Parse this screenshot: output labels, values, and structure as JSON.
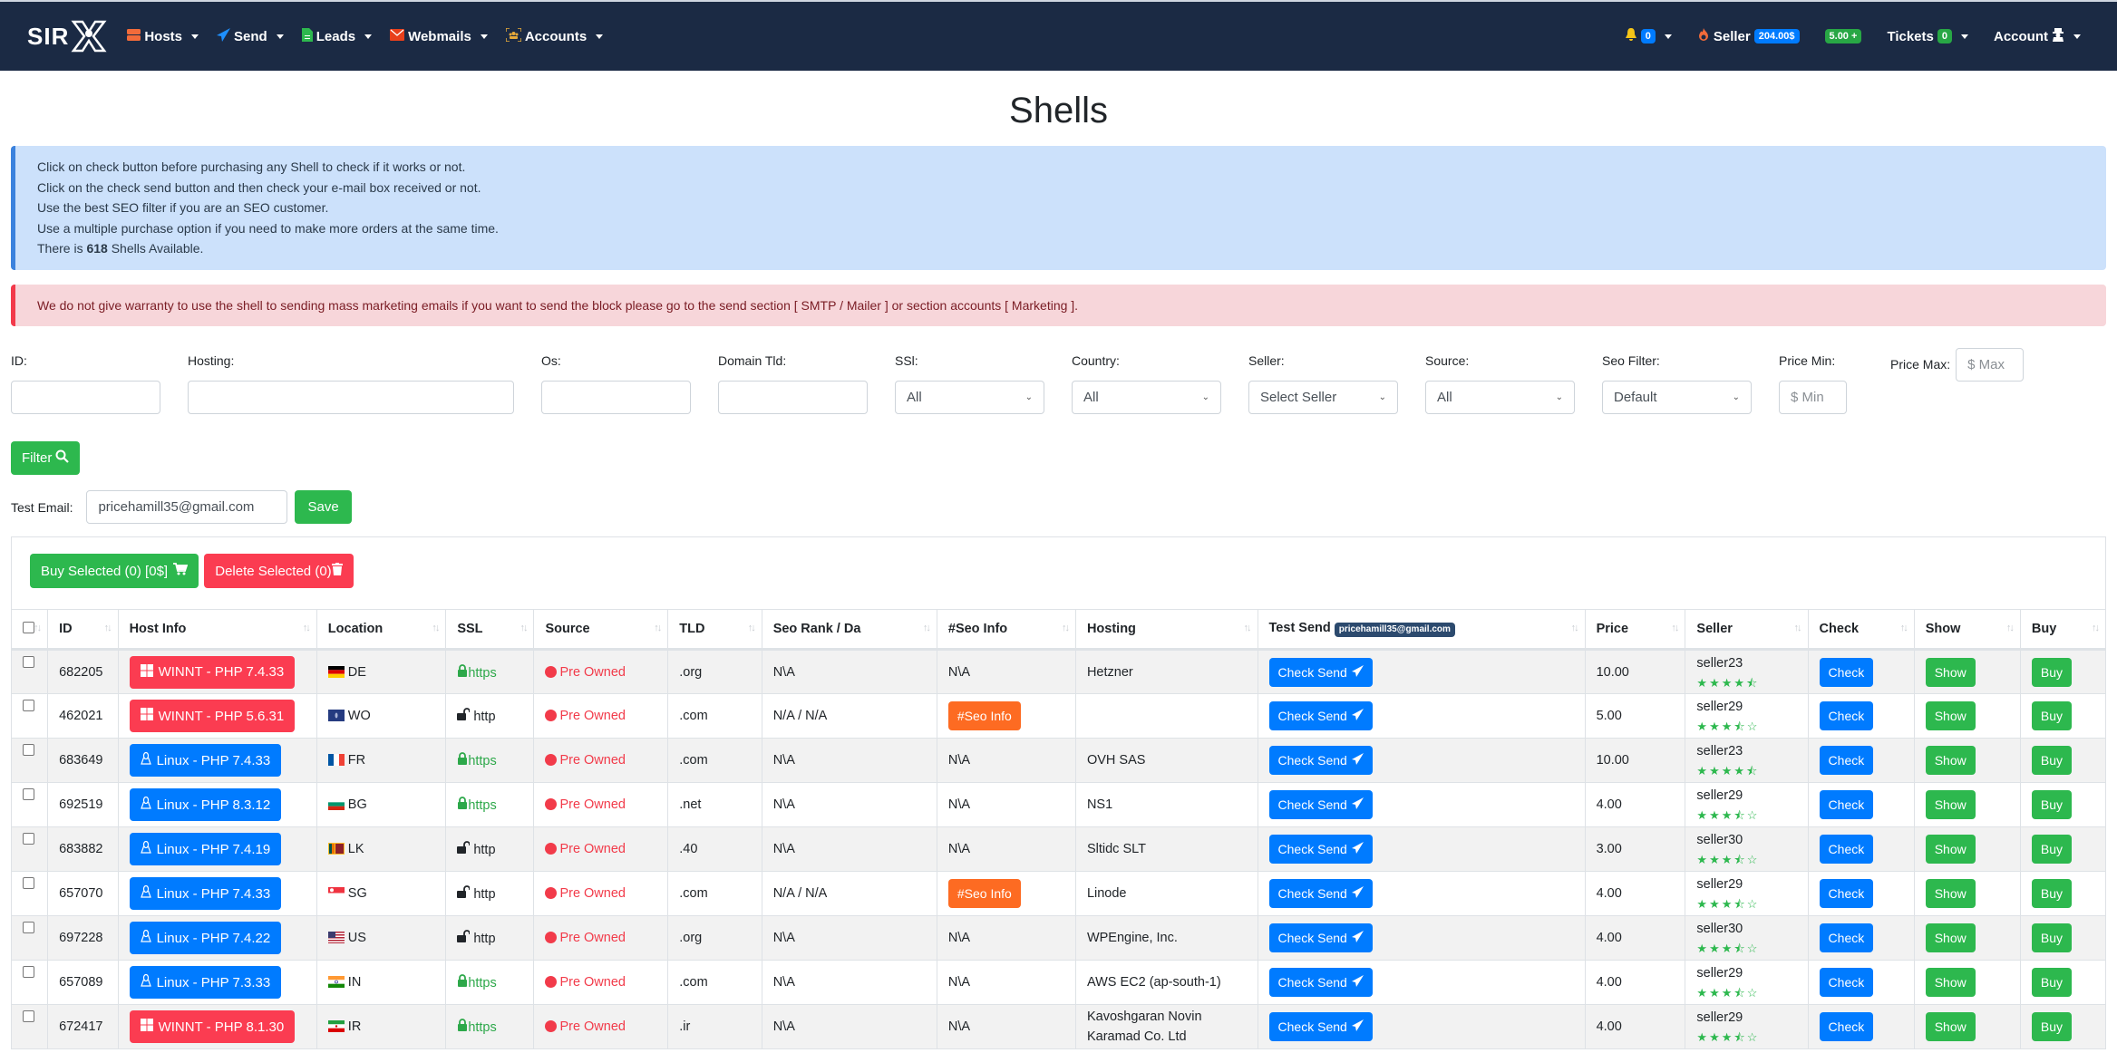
{
  "nav": {
    "logo_text": "SIR",
    "items": [
      {
        "label": "Hosts",
        "icon": "server-icon",
        "color": "#f26b3a"
      },
      {
        "label": "Send",
        "icon": "paper-plane-icon",
        "color": "#1e90ff"
      },
      {
        "label": "Leads",
        "icon": "file-icon",
        "color": "#2db84e"
      },
      {
        "label": "Webmails",
        "icon": "envelope-icon",
        "color": "#e8401c"
      },
      {
        "label": "Accounts",
        "icon": "users-icon",
        "color": "#e6a93a"
      }
    ],
    "notifications_count": "0",
    "seller_label": "Seller",
    "seller_balance": "204.00$",
    "balance_add": "5.00",
    "tickets_label": "Tickets",
    "tickets_count": "0",
    "account_label": "Account"
  },
  "page_title": "Shells",
  "info_alert": {
    "lines": [
      "Click on check button before purchasing any Shell to check if it works or not.",
      "Click on the check send button and then check your e-mail box received or not.",
      "Use the best SEO filter if you are an SEO customer.",
      "Use a multiple purchase option if you need to make more orders at the same time."
    ],
    "available_prefix": "There is",
    "available_count": "618",
    "available_suffix": "Shells Available."
  },
  "danger_alert": "We do not give warranty to use the shell to sending mass marketing emails if you want to send the block please go to the send section [ SMTP / Mailer ] or section accounts [ Marketing ].",
  "filters": {
    "id_label": "ID:",
    "hosting_label": "Hosting:",
    "os_label": "Os:",
    "tld_label": "Domain Tld:",
    "ssl_label": "SSl:",
    "ssl_value": "All",
    "country_label": "Country:",
    "country_value": "All",
    "seller_label": "Seller:",
    "seller_value": "Select Seller",
    "source_label": "Source:",
    "source_value": "All",
    "seo_label": "Seo Filter:",
    "seo_value": "Default",
    "price_min_label": "Price Min:",
    "price_min_placeholder": "$ Min",
    "price_max_label": "Price Max:",
    "price_max_placeholder": "$ Max",
    "filter_button": "Filter"
  },
  "test_email": {
    "label": "Test Email:",
    "value": "pricehamill35@gmail.com",
    "save_button": "Save"
  },
  "bulk": {
    "buy_selected": "Buy Selected (0) [0$]",
    "delete_selected": "Delete Selected (0)"
  },
  "table": {
    "headers": [
      "ID",
      "Host Info",
      "Location",
      "SSL",
      "Source",
      "TLD",
      "Seo Rank / Da",
      "#Seo Info",
      "Hosting",
      "Test Send",
      "Price",
      "Seller",
      "Check",
      "Show",
      "Buy"
    ],
    "test_send_email_badge": "pricehamill35@gmail.com",
    "check_send_label": "Check Send",
    "check_label": "Check",
    "show_label": "Show",
    "buy_label": "Buy",
    "rows": [
      {
        "id": "682205",
        "os": "windows",
        "host": "WINNT - PHP 7.4.33",
        "flag": "DE",
        "country": "DE",
        "ssl": "https",
        "source": "Pre Owned",
        "tld": ".org",
        "seo_rank": "N\\A",
        "seo_info": "N\\A",
        "seo_info_button": false,
        "hosting": "Hetzner",
        "price": "10.00",
        "seller": "seller23",
        "rating": 4.5
      },
      {
        "id": "462021",
        "os": "windows",
        "host": "WINNT - PHP 5.6.31",
        "flag": "WO",
        "country": "WO",
        "ssl": "http",
        "source": "Pre Owned",
        "tld": ".com",
        "seo_rank": "N/A / N/A",
        "seo_info": "#Seo Info",
        "seo_info_button": true,
        "hosting": "",
        "price": "5.00",
        "seller": "seller29",
        "rating": 3.5
      },
      {
        "id": "683649",
        "os": "linux",
        "host": "Linux - PHP 7.4.33",
        "flag": "FR",
        "country": "FR",
        "ssl": "https",
        "source": "Pre Owned",
        "tld": ".com",
        "seo_rank": "N\\A",
        "seo_info": "N\\A",
        "seo_info_button": false,
        "hosting": "OVH SAS",
        "price": "10.00",
        "seller": "seller23",
        "rating": 4.5
      },
      {
        "id": "692519",
        "os": "linux",
        "host": "Linux - PHP 8.3.12",
        "flag": "BG",
        "country": "BG",
        "ssl": "https",
        "source": "Pre Owned",
        "tld": ".net",
        "seo_rank": "N\\A",
        "seo_info": "N\\A",
        "seo_info_button": false,
        "hosting": "NS1",
        "price": "4.00",
        "seller": "seller29",
        "rating": 3.5
      },
      {
        "id": "683882",
        "os": "linux",
        "host": "Linux - PHP 7.4.19",
        "flag": "LK",
        "country": "LK",
        "ssl": "http",
        "source": "Pre Owned",
        "tld": ".40",
        "seo_rank": "N\\A",
        "seo_info": "N\\A",
        "seo_info_button": false,
        "hosting": "Sltidc SLT",
        "price": "3.00",
        "seller": "seller30",
        "rating": 3.5
      },
      {
        "id": "657070",
        "os": "linux",
        "host": "Linux - PHP 7.4.33",
        "flag": "SG",
        "country": "SG",
        "ssl": "http",
        "source": "Pre Owned",
        "tld": ".com",
        "seo_rank": "N/A / N/A",
        "seo_info": "#Seo Info",
        "seo_info_button": true,
        "hosting": "Linode",
        "price": "4.00",
        "seller": "seller29",
        "rating": 3.5
      },
      {
        "id": "697228",
        "os": "linux",
        "host": "Linux - PHP 7.4.22",
        "flag": "US",
        "country": "US",
        "ssl": "http",
        "source": "Pre Owned",
        "tld": ".org",
        "seo_rank": "N\\A",
        "seo_info": "N\\A",
        "seo_info_button": false,
        "hosting": "WPEngine, Inc.",
        "price": "4.00",
        "seller": "seller30",
        "rating": 3.5
      },
      {
        "id": "657089",
        "os": "linux",
        "host": "Linux - PHP 7.3.33",
        "flag": "IN",
        "country": "IN",
        "ssl": "https",
        "source": "Pre Owned",
        "tld": ".com",
        "seo_rank": "N\\A",
        "seo_info": "N\\A",
        "seo_info_button": false,
        "hosting": "AWS EC2 (ap-south-1)",
        "price": "4.00",
        "seller": "seller29",
        "rating": 3.5
      },
      {
        "id": "672417",
        "os": "windows",
        "host": "WINNT - PHP 8.1.30",
        "flag": "IR",
        "country": "IR",
        "ssl": "https",
        "source": "Pre Owned",
        "tld": ".ir",
        "seo_rank": "N\\A",
        "seo_info": "N\\A",
        "seo_info_button": false,
        "hosting": "Kavoshgaran Novin Karamad Co. Ltd",
        "price": "4.00",
        "seller": "seller29",
        "rating": 3.5
      }
    ]
  },
  "colors": {
    "navbar": "#1b2a44",
    "success": "#2db84e",
    "danger": "#fb3c51",
    "primary": "#007bff",
    "orange": "#fd6b22"
  }
}
